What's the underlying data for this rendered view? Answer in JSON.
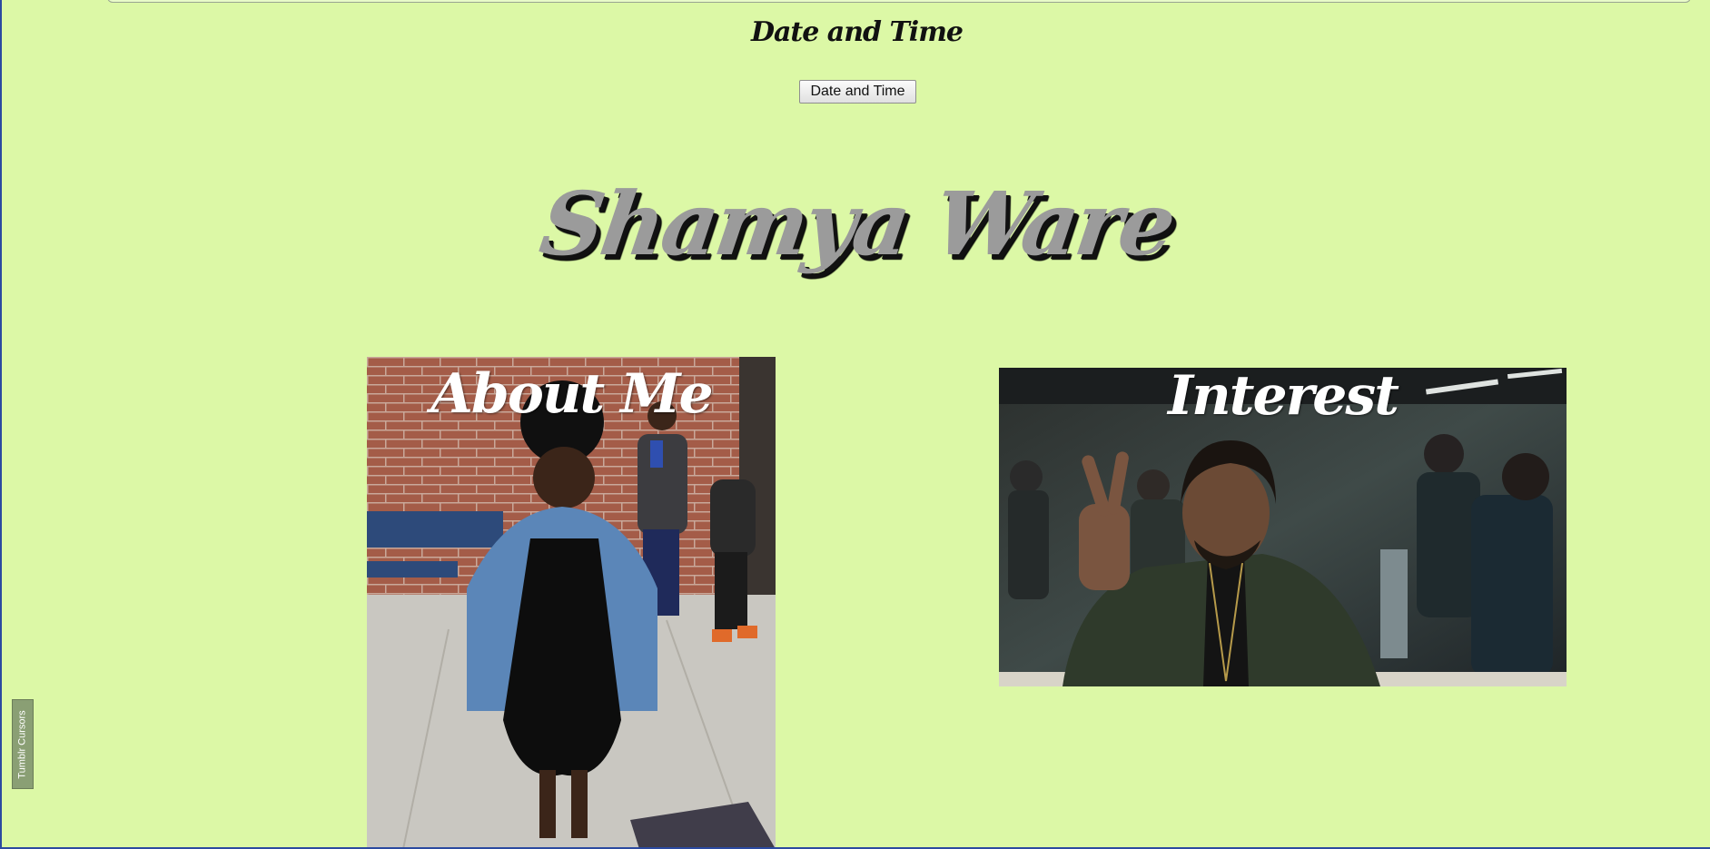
{
  "header": {
    "datetime_heading": "Date and Time",
    "datetime_button_label": "Date and Time"
  },
  "title": {
    "name": "Shamya Ware"
  },
  "cards": [
    {
      "label": "About Me",
      "photo": "girl in denim jacket in front of brick wall"
    },
    {
      "label": "Interest",
      "photo": "man in green jacket giving peace sign"
    }
  ],
  "tumblr_tab": {
    "label": "Tumblr Cursors"
  },
  "colors": {
    "page_background": "#dcf8a6",
    "title_fill": "#9b9b9b",
    "title_shadow": "#111111",
    "card_label": "#ffffff",
    "tab_background": "#8a9f74"
  }
}
